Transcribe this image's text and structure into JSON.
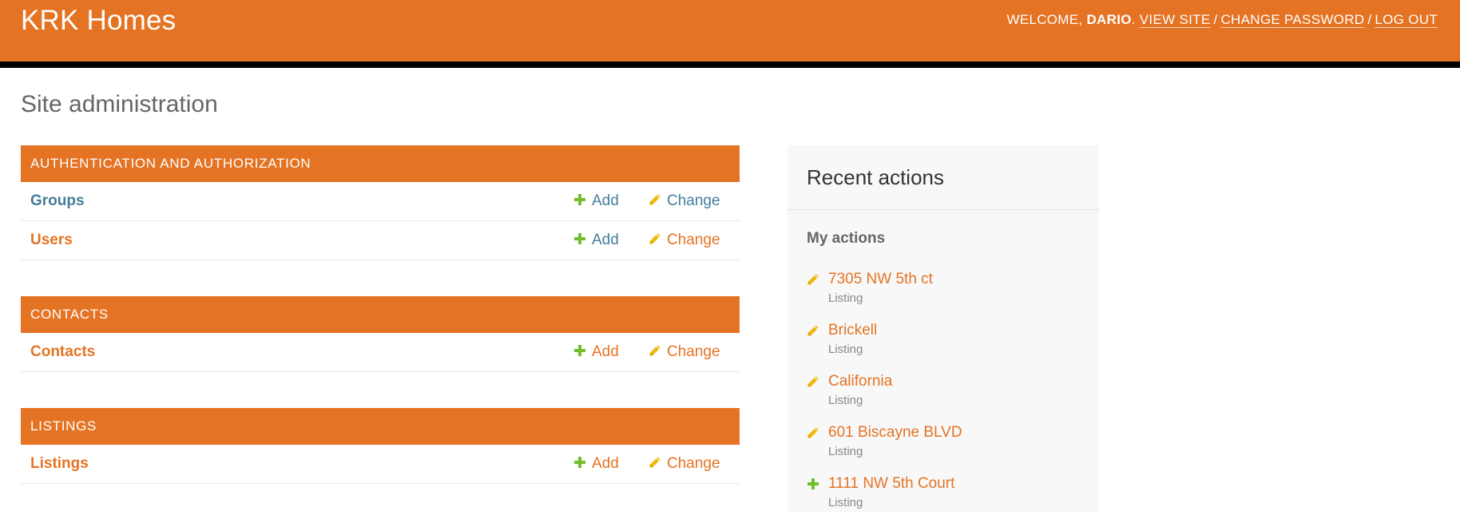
{
  "colors": {
    "brand": "#e57324",
    "link_blue": "#447e9b",
    "link_orange": "#e57324",
    "add_green": "#70bf2b",
    "change_yellow": "#efb80b"
  },
  "header": {
    "site_name": "KRK Homes",
    "welcome": "WELCOME,",
    "username": "DARIO",
    "view_site": "VIEW SITE",
    "change_password": "CHANGE PASSWORD",
    "log_out": "LOG OUT",
    "separator": "/"
  },
  "page_title": "Site administration",
  "modules": [
    {
      "caption": "AUTHENTICATION AND AUTHORIZATION",
      "models": [
        {
          "name": "Groups",
          "add": "Add",
          "change": "Change"
        },
        {
          "name": "Users",
          "add": "Add",
          "change": "Change"
        }
      ]
    },
    {
      "caption": "CONTACTS",
      "models": [
        {
          "name": "Contacts",
          "add": "Add",
          "change": "Change"
        }
      ]
    },
    {
      "caption": "LISTINGS",
      "models": [
        {
          "name": "Listings",
          "add": "Add",
          "change": "Change"
        }
      ]
    }
  ],
  "recent_actions": {
    "title": "Recent actions",
    "subtitle": "My actions",
    "items": [
      {
        "icon": "pencil-icon",
        "title": "7305 NW 5th ct",
        "type": "Listing"
      },
      {
        "icon": "pencil-icon",
        "title": "Brickell",
        "type": "Listing"
      },
      {
        "icon": "pencil-icon",
        "title": "California",
        "type": "Listing"
      },
      {
        "icon": "pencil-icon",
        "title": "601 Biscayne BLVD",
        "type": "Listing"
      },
      {
        "icon": "plus-icon",
        "title": "1111 NW 5th Court",
        "type": "Listing"
      }
    ]
  }
}
